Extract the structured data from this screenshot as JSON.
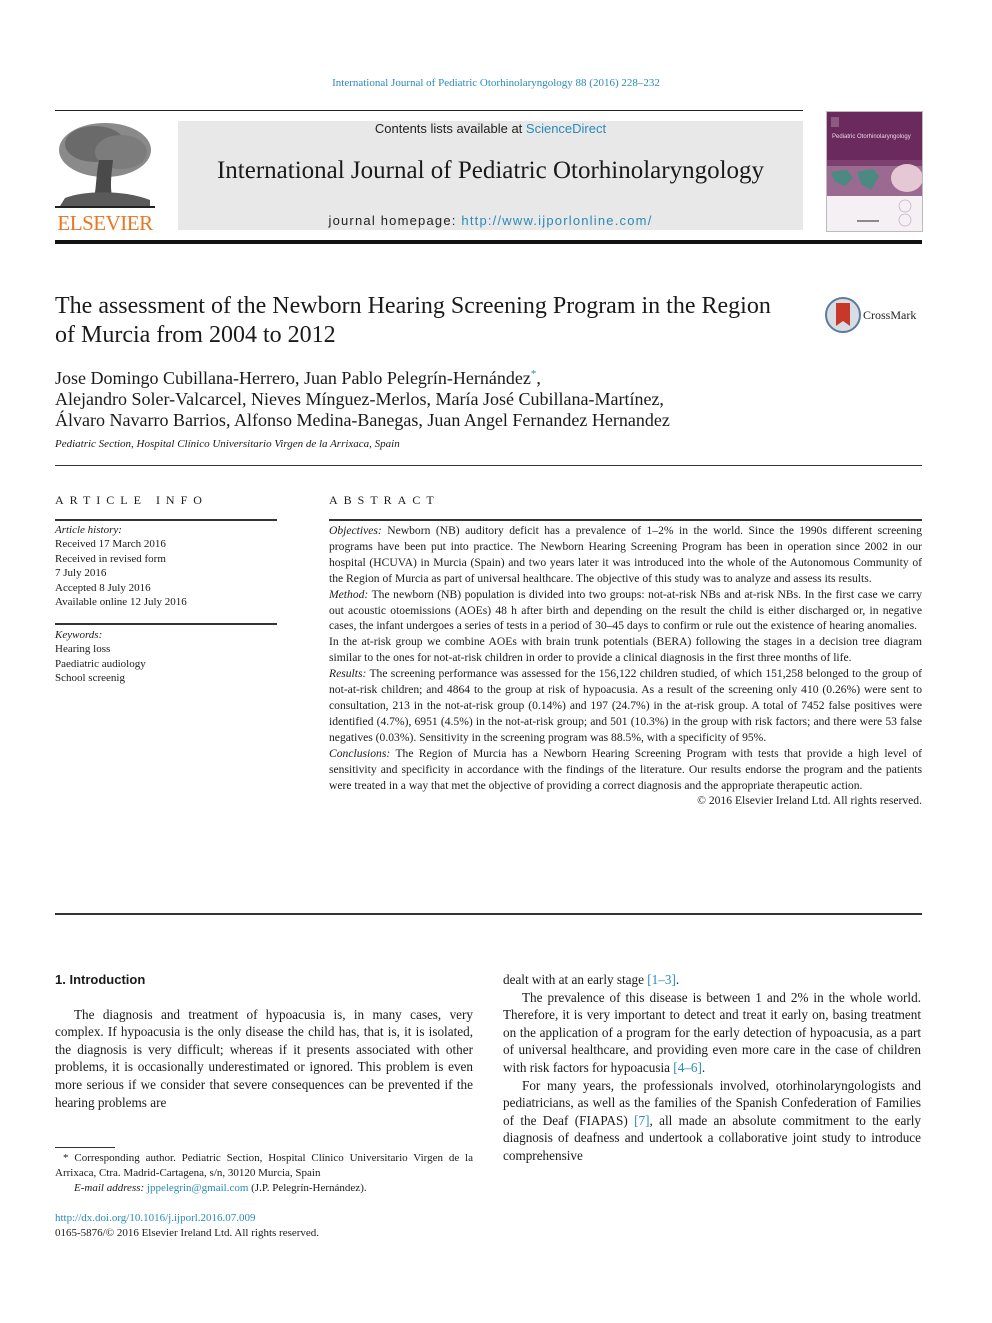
{
  "citation": "International Journal of Pediatric Otorhinolaryngology 88 (2016) 228–232",
  "header": {
    "contents_prefix": "Contents lists available at ",
    "contents_link": "ScienceDirect",
    "journal_title": "International Journal of Pediatric Otorhinolaryngology",
    "homepage_prefix": "journal homepage: ",
    "homepage_link": "http://www.ijporlonline.com/",
    "publisher_logo_text": "ELSEVIER",
    "cover_title": "Pediatric Otorhinolaryngology"
  },
  "article": {
    "title": "The assessment of the Newborn Hearing Screening Program in the Region of Murcia from 2004 to 2012",
    "crossmark_label": "CrossMark",
    "authors_line1": "Jose Domingo Cubillana-Herrero, Juan Pablo Pelegrín-Hernández",
    "authors_line1_mark": "*",
    "authors_line1_end": ",",
    "authors_line2": "Alejandro Soler-Valcarcel, Nieves Mínguez-Merlos, María José Cubillana-Martínez,",
    "authors_line3": "Álvaro Navarro Barrios, Alfonso Medina-Banegas, Juan Angel Fernandez Hernandez",
    "affiliation": "Pediatric Section, Hospital Clínico Universitario Virgen de la Arrixaca, Spain"
  },
  "article_info": {
    "heading": "ARTICLE INFO",
    "history_label": "Article history:",
    "history": [
      "Received 17 March 2016",
      "Received in revised form",
      "7 July 2016",
      "Accepted 8 July 2016",
      "Available online 12 July 2016"
    ],
    "keywords_label": "Keywords:",
    "keywords": [
      "Hearing loss",
      "Paediatric audiology",
      "School screenig"
    ]
  },
  "abstract": {
    "heading": "ABSTRACT",
    "objectives_label": "Objectives:",
    "objectives": " Newborn (NB) auditory deficit has a prevalence of 1–2% in the world. Since the 1990s different screening programs have been put into practice. The Newborn Hearing Screening Program has been in operation since 2002 in our hospital (HCUVA) in Murcia (Spain) and two years later it was introduced into the whole of the Autonomous Community of the Region of Murcia as part of universal healthcare. The objective of this study was to analyze and assess its results.",
    "method_label": "Method:",
    "method": "  The newborn (NB) population is divided into two groups: not-at-risk NBs and at-risk NBs. In the first case we carry out acoustic otoemissions (AOEs) 48 h after birth and depending on the result the child is either discharged or, in negative cases, the infant undergoes a series of tests in a period of 30–45 days to confirm or rule out the existence of hearing anomalies.",
    "method_2": "In the at-risk group we combine AOEs with brain trunk potentials (BERA) following the stages in a decision tree diagram similar to the ones for not-at-risk children in order to provide a clinical diagnosis in the first three months of life.",
    "results_label": "Results:",
    "results": " The screening performance was assessed for the 156,122 children studied, of which 151,258 belonged to the group of not-at-risk children; and 4864 to the group at risk of hypoacusia. As a result of the screening only 410 (0.26%) were sent to consultation, 213 in the not-at-risk group (0.14%) and 197 (24.7%) in the at-risk group. A total of 7452 false positives were identified (4.7%), 6951 (4.5%) in the not-at-risk group; and 501 (10.3%) in the group with risk factors; and there were 53 false negatives (0.03%). Sensitivity in the screening program was 88.5%, with a specificity of 95%.",
    "conclusions_label": "Conclusions:",
    "conclusions": "  The Region of Murcia has a Newborn Hearing Screening Program with tests that provide a high level of sensitivity and specificity in accordance with the findings of the literature. Our results endorse the program and the patients were treated in a way that met the objective of providing a correct diagnosis and the appropriate therapeutic action.",
    "copyright": "© 2016 Elsevier Ireland Ltd. All rights reserved."
  },
  "body": {
    "intro_heading": "1.  Introduction",
    "left_para": "The diagnosis and treatment of hypoacusia is, in many cases, very complex. If hypoacusia is the only disease the child has, that is, it is isolated, the diagnosis is very difficult; whereas if it presents associated with other problems, it is occasionally underestimated or ignored. This problem is even more serious if we consider that severe consequences can be prevented if the hearing problems are",
    "right_p1_text": "dealt with at an early stage ",
    "right_p1_ref": "[1–3]",
    "right_p1_end": ".",
    "right_p2_text": "The prevalence of this disease is between 1 and 2% in the whole world. Therefore, it is very important to detect and treat it early on, basing treatment on the application of a program for the early detection of hypoacusia, as a part of universal healthcare, and providing even more care in the case of children with risk factors for hypoacusia ",
    "right_p2_ref": "[4–6]",
    "right_p2_end": ".",
    "right_p3_text": "For many years, the professionals involved, otorhinolaryngologists and pediatricians, as well as the families of the Spanish Confederation of Families of the Deaf (FIAPAS) ",
    "right_p3_ref": "[7]",
    "right_p3_end": ", all made an absolute commitment to the early diagnosis of deafness and undertook a collaborative joint study to introduce comprehensive"
  },
  "footnote": {
    "corresponding": "* Corresponding author. Pediatric Section, Hospital Clínico Universitario Virgen de la Arrixaca, Ctra. Madrid-Cartagena, s/n, 30120 Murcia, Spain",
    "email_label": "E-mail address: ",
    "email": "jppelegrin@gmail.com",
    "email_owner": " (J.P. Pelegrín-Hernández).",
    "doi": "http://dx.doi.org/10.1016/j.ijporl.2016.07.009",
    "issn_line": "0165-5876/© 2016 Elsevier Ireland Ltd. All rights reserved."
  },
  "colors": {
    "link": "#2a8ab8",
    "elsevier_orange": "#e87722",
    "header_box": "#e8e8e8",
    "cover_purple": "#6b2a5e"
  }
}
